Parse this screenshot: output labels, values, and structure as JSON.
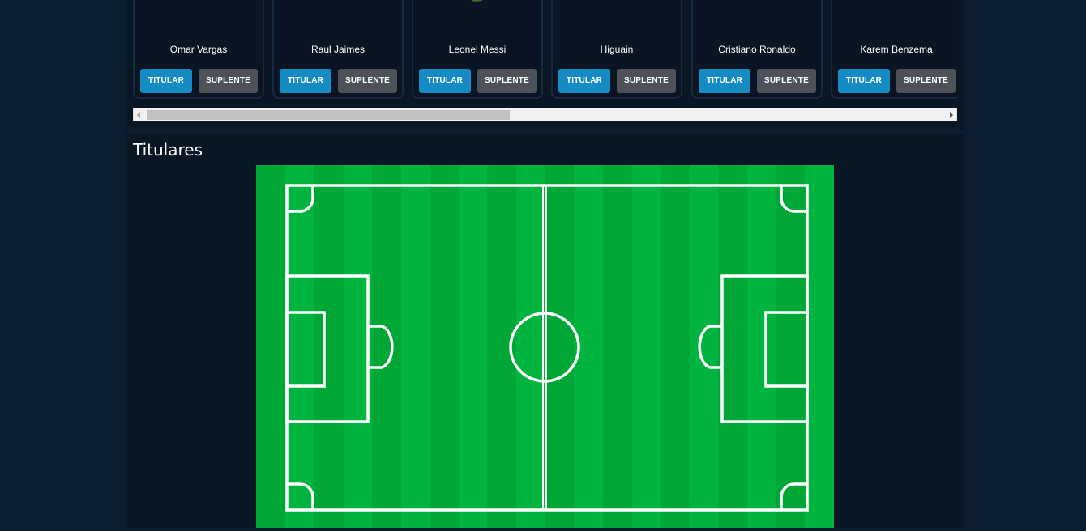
{
  "players": [
    {
      "name": "Omar Vargas",
      "titular_label": "TITULAR",
      "suplente_label": "SUPLENTE"
    },
    {
      "name": "Raul Jaimes",
      "titular_label": "TITULAR",
      "suplente_label": "SUPLENTE"
    },
    {
      "name": "Leonel Messi",
      "titular_label": "TITULAR",
      "suplente_label": "SUPLENTE"
    },
    {
      "name": "Higuain",
      "titular_label": "TITULAR",
      "suplente_label": "SUPLENTE"
    },
    {
      "name": "Cristiano Ronaldo",
      "titular_label": "TITULAR",
      "suplente_label": "SUPLENTE"
    },
    {
      "name": "Karem Benzema",
      "titular_label": "TITULAR",
      "suplente_label": "SUPLENTE"
    }
  ],
  "titulares": {
    "title": "Titulares"
  },
  "colors": {
    "titular_button": "#168bc3",
    "suplente_button": "#4d5259",
    "field_light": "#00b43f",
    "field_dark": "#00a736",
    "lines": "#ffffff"
  }
}
